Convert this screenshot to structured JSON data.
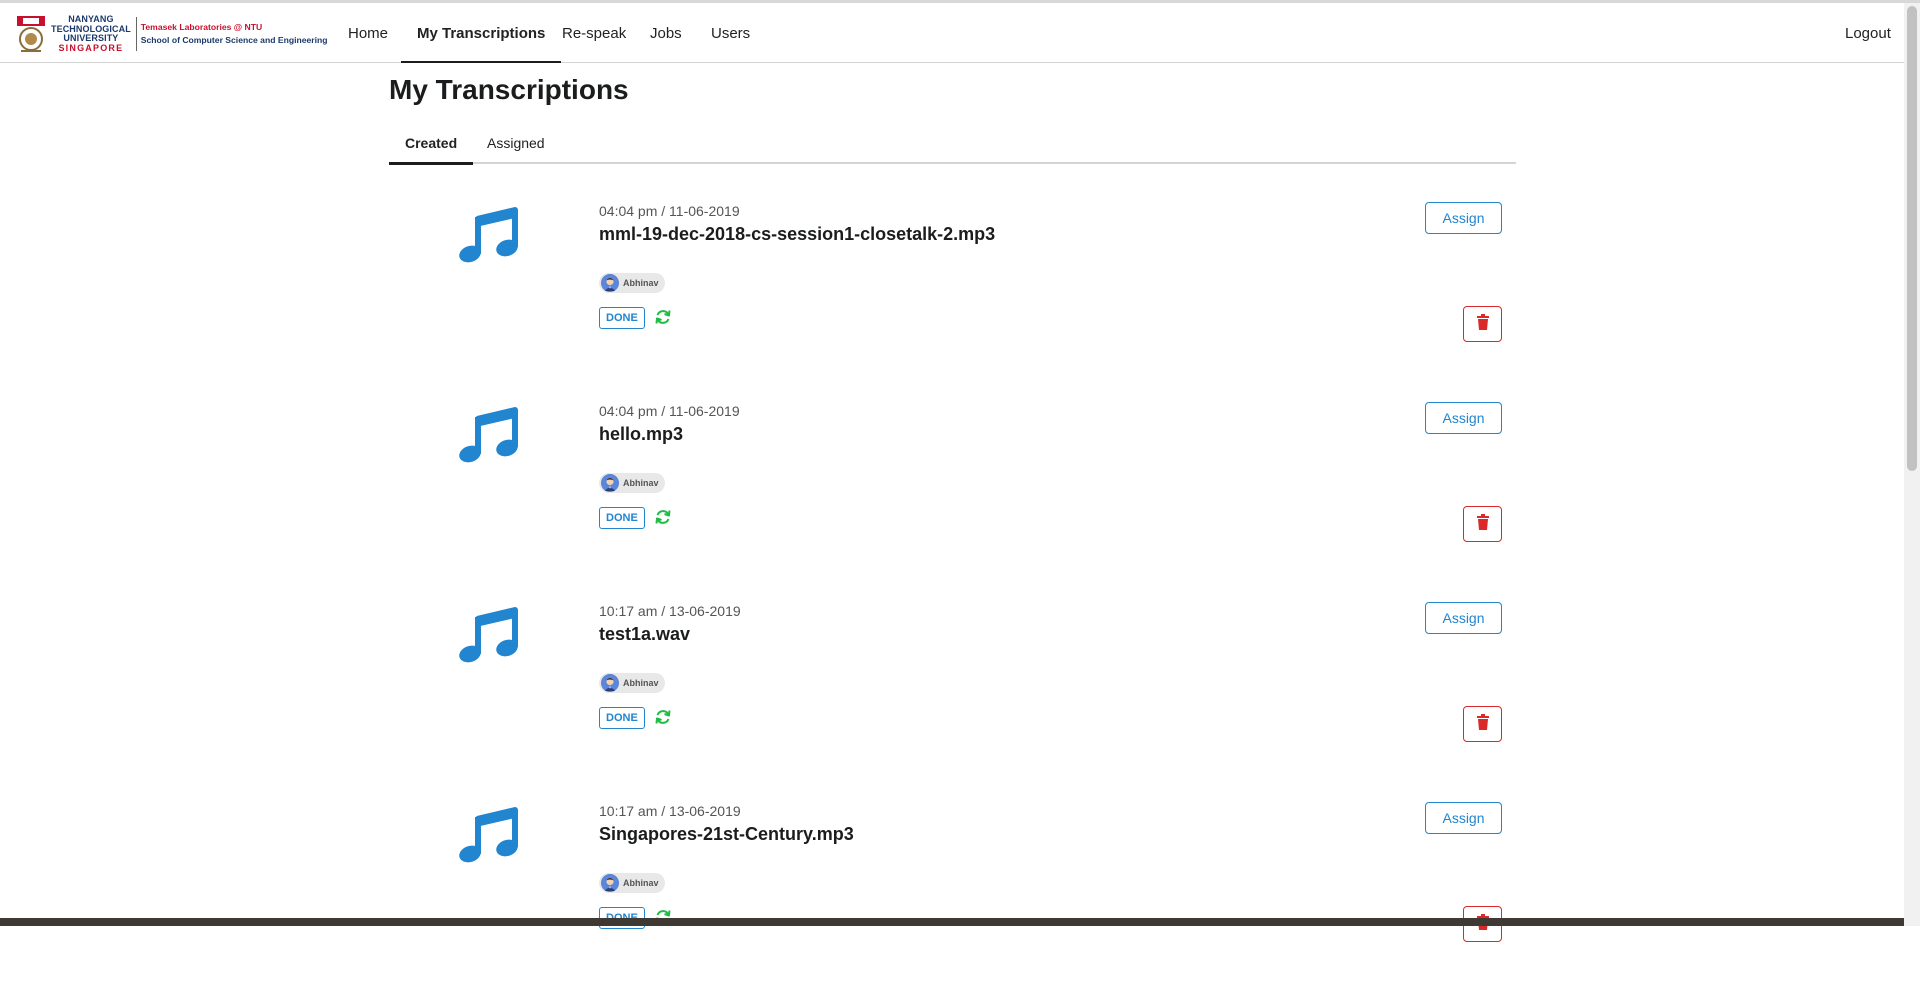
{
  "logo": {
    "university_line1": "NANYANG",
    "university_line2": "TECHNOLOGICAL",
    "university_line3": "UNIVERSITY",
    "university_line4": "SINGAPORE",
    "lab_line1": "Temasek Laboratories @ NTU",
    "lab_line2": "School of Computer Science and Engineering"
  },
  "nav": {
    "items": [
      {
        "label": "Home"
      },
      {
        "label": "My Transcriptions"
      },
      {
        "label": "Re-speak"
      },
      {
        "label": "Jobs"
      },
      {
        "label": "Users"
      }
    ],
    "logout": "Logout",
    "active": "My Transcriptions"
  },
  "page": {
    "title": "My Transcriptions",
    "tabs": [
      {
        "label": "Created"
      },
      {
        "label": "Assigned"
      }
    ],
    "active_tab": "Created"
  },
  "transcriptions": [
    {
      "timestamp": "04:04 pm / 11-06-2019",
      "filename": "mml-19-dec-2018-cs-session1-closetalk-2.mp3",
      "user": "Abhinav",
      "status": "DONE",
      "assign_label": "Assign"
    },
    {
      "timestamp": "04:04 pm / 11-06-2019",
      "filename": "hello.mp3",
      "user": "Abhinav",
      "status": "DONE",
      "assign_label": "Assign"
    },
    {
      "timestamp": "10:17 am / 13-06-2019",
      "filename": "test1a.wav",
      "user": "Abhinav",
      "status": "DONE",
      "assign_label": "Assign"
    },
    {
      "timestamp": "10:17 am / 13-06-2019",
      "filename": "Singapores-21st-Century.mp3",
      "user": "Abhinav",
      "status": "DONE",
      "assign_label": "Assign"
    }
  ],
  "icons": {
    "file": "music-note-icon",
    "refresh": "refresh-icon",
    "delete": "trash-icon",
    "user": "user-avatar"
  },
  "colors": {
    "primary": "#2185d0",
    "danger": "#db2828",
    "success": "#21ba45",
    "ntu_red": "#c8102e",
    "ntu_blue": "#1b3a6b"
  }
}
